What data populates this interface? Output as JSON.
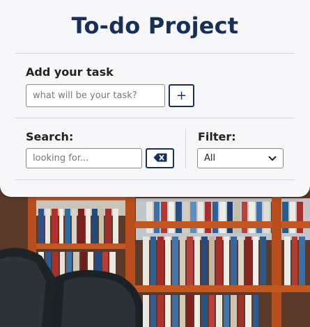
{
  "app": {
    "title": "To-do Project"
  },
  "add_task": {
    "label": "Add your task",
    "input_value": "",
    "input_placeholder": "what will be your task?",
    "add_button_icon": "plus-icon"
  },
  "search": {
    "label": "Search:",
    "input_value": "",
    "input_placeholder": "looking for...",
    "clear_button_icon": "backspace-icon"
  },
  "filter": {
    "label": "Filter:",
    "selected": "All"
  },
  "colors": {
    "brand": "#16305a",
    "card_background": "#f7f7f9"
  }
}
